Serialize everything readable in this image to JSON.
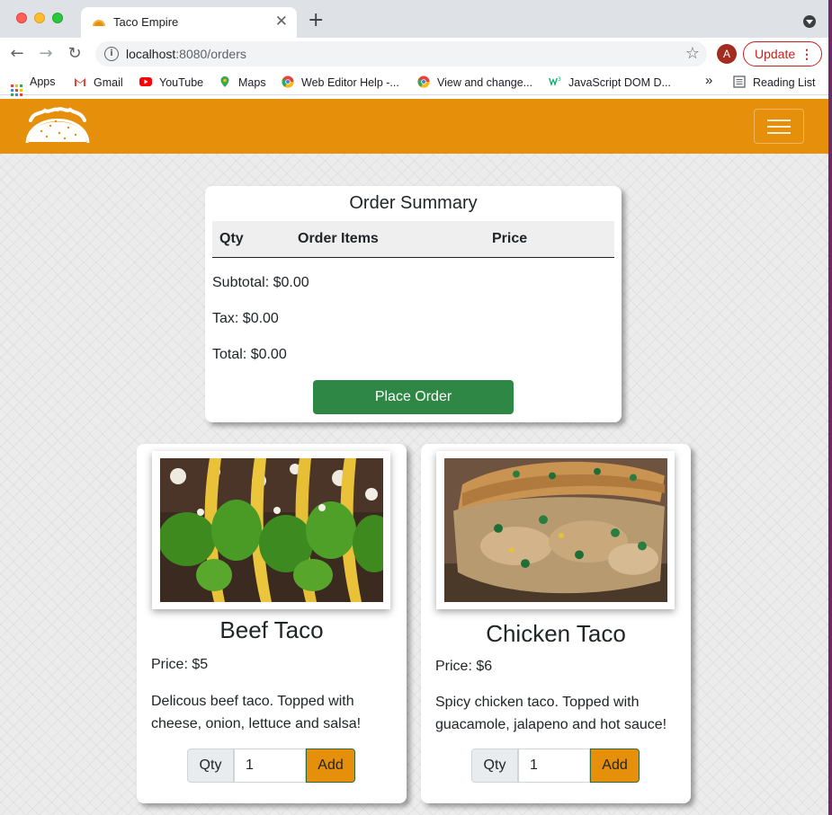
{
  "browser": {
    "tab_title": "Taco Empire",
    "tab_close": "✕",
    "new_tab": "+",
    "url_host": "localhost",
    "url_path": ":8080/orders",
    "avatar_letter": "A",
    "update_label": "Update",
    "bookmarks": [
      "Apps",
      "Gmail",
      "YouTube",
      "Maps",
      "Web Editor Help -...",
      "View and change...",
      "JavaScript DOM D..."
    ],
    "bookmarks_overflow": "»",
    "reading_list": "Reading List"
  },
  "navbar": {
    "brand_color": "#e58f0b"
  },
  "order_summary": {
    "title": "Order Summary",
    "columns": [
      "Qty",
      "Order Items",
      "Price"
    ],
    "subtotal": "Subtotal: $0.00",
    "tax": "Tax: $0.00",
    "total": "Total: $0.00",
    "place_order": "Place Order"
  },
  "products": [
    {
      "name": "Beef Taco",
      "price": "Price: $5",
      "description": "Delicous beef taco. Topped with cheese, onion, lettuce and salsa!",
      "qty_label": "Qty",
      "qty_value": "1",
      "add_label": "Add",
      "image": "beef-taco-photo"
    },
    {
      "name": "Chicken Taco",
      "price": "Price: $6",
      "description": "Spicy chicken taco. Topped with guacamole, jalapeno and hot sauce!",
      "qty_label": "Qty",
      "qty_value": "1",
      "add_label": "Add",
      "image": "chicken-taco-photo"
    }
  ],
  "colors": {
    "accent": "#e58f0b",
    "success": "#2f8746"
  }
}
